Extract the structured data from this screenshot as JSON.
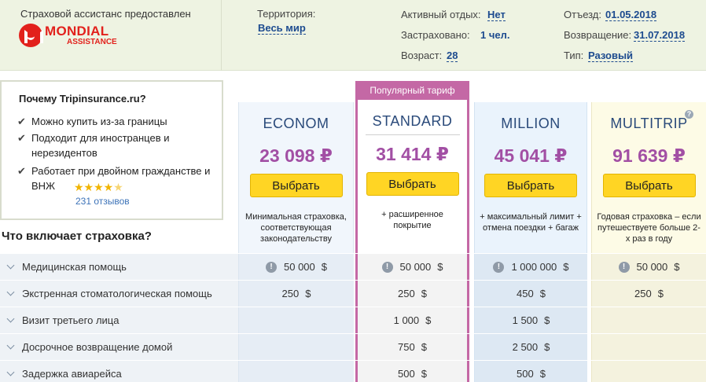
{
  "header": {
    "provider_text": "Страховой ассистанс предоставлен",
    "logo_main": "MONDIAL",
    "logo_sub": "ASSISTANCE",
    "territory_label": "Территория:",
    "territory_value": "Весь мир",
    "active_label": "Активный отдых:",
    "active_value": "Нет",
    "insured_label": "Застраховано:",
    "insured_value": "1 чел.",
    "age_label": "Возраст:",
    "age_value": "28",
    "departure_label": "Отъезд:",
    "departure_value": "01.05.2018",
    "return_label": "Возвращение:",
    "return_value": "31.07.2018",
    "type_label": "Тип:",
    "type_value": "Разовый"
  },
  "why": {
    "title": "Почему Tripinsurance.ru?",
    "items": [
      "Можно купить из-за границы",
      "Подходит для иностранцев и нерезидентов",
      "Работает при двойном гражданстве и ВНЖ"
    ],
    "rating": 4.5,
    "reviews": "231 отзывов"
  },
  "section_title": "Что включает страховка?",
  "popular_label": "Популярный тариф",
  "select_label": "Выбрать",
  "plans": [
    {
      "name": "ECONOM",
      "price": "23 098 ₽",
      "desc": "Минимальная страховка, соответствующая законодательству"
    },
    {
      "name": "STANDARD",
      "price": "31 414 ₽",
      "desc": "+ расширенное покрытие"
    },
    {
      "name": "MILLION",
      "price": "45 041 ₽",
      "desc": "+ максимальный лимит + отмена поездки + багаж"
    },
    {
      "name": "MULTITRIP",
      "price": "91 639 ₽",
      "desc": "Годовая страховка – если путешествуете больше 2-х раз в году"
    }
  ],
  "currency": "$",
  "rows": [
    {
      "label": "Медицинская помощь",
      "values": [
        "50 000",
        "50 000",
        "1 000 000",
        "50 000"
      ],
      "warn": true
    },
    {
      "label": "Экстренная стоматологическая помощь",
      "values": [
        "250",
        "250",
        "450",
        "250"
      ],
      "warn": false
    },
    {
      "label": "Визит третьего лица",
      "values": [
        "",
        "1 000",
        "1 500",
        ""
      ],
      "warn": false
    },
    {
      "label": "Досрочное возвращение домой",
      "values": [
        "",
        "750",
        "2 500",
        ""
      ],
      "warn": false
    },
    {
      "label": "Задержка авиарейса",
      "values": [
        "",
        "500",
        "500",
        ""
      ],
      "warn": false
    }
  ],
  "colors": {
    "accent_purple": "#a24fa4",
    "popular_border": "#c468a5",
    "button_yellow": "#ffd524",
    "link_blue": "#1d4b8f"
  }
}
